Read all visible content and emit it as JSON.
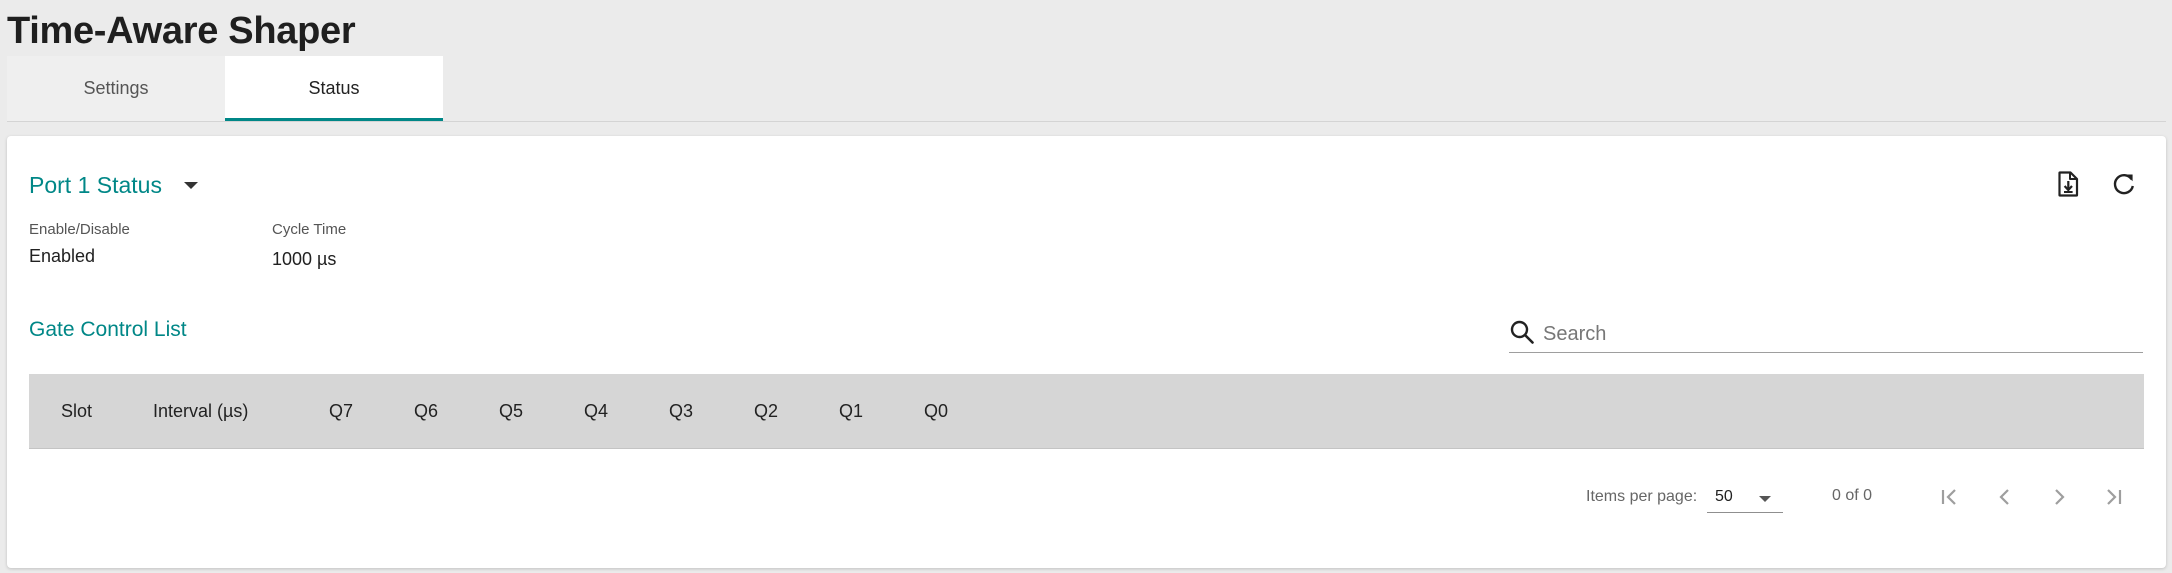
{
  "page": {
    "title": "Time-Aware Shaper"
  },
  "tabs": [
    {
      "label": "Settings",
      "active": false
    },
    {
      "label": "Status",
      "active": true
    }
  ],
  "port_selector": {
    "label": "Port 1 Status"
  },
  "toolbar": {
    "export_icon": "file-download-icon",
    "refresh_icon": "refresh-icon"
  },
  "fields": {
    "enable": {
      "label": "Enable/Disable",
      "value": "Enabled"
    },
    "cycle_time": {
      "label": "Cycle Time",
      "value": "1000 µs"
    }
  },
  "gate_control_list": {
    "title": "Gate Control List",
    "search": {
      "placeholder": "Search",
      "value": ""
    },
    "columns": [
      "Slot",
      "Interval (µs)",
      "Q7",
      "Q6",
      "Q5",
      "Q4",
      "Q3",
      "Q2",
      "Q1",
      "Q0"
    ],
    "rows": []
  },
  "paginator": {
    "items_per_page_label": "Items per page:",
    "items_per_page": "50",
    "range": "0 of 0"
  },
  "colors": {
    "accent": "#008787",
    "header_bg": "#d6d6d6",
    "page_bg": "#ebebeb"
  }
}
